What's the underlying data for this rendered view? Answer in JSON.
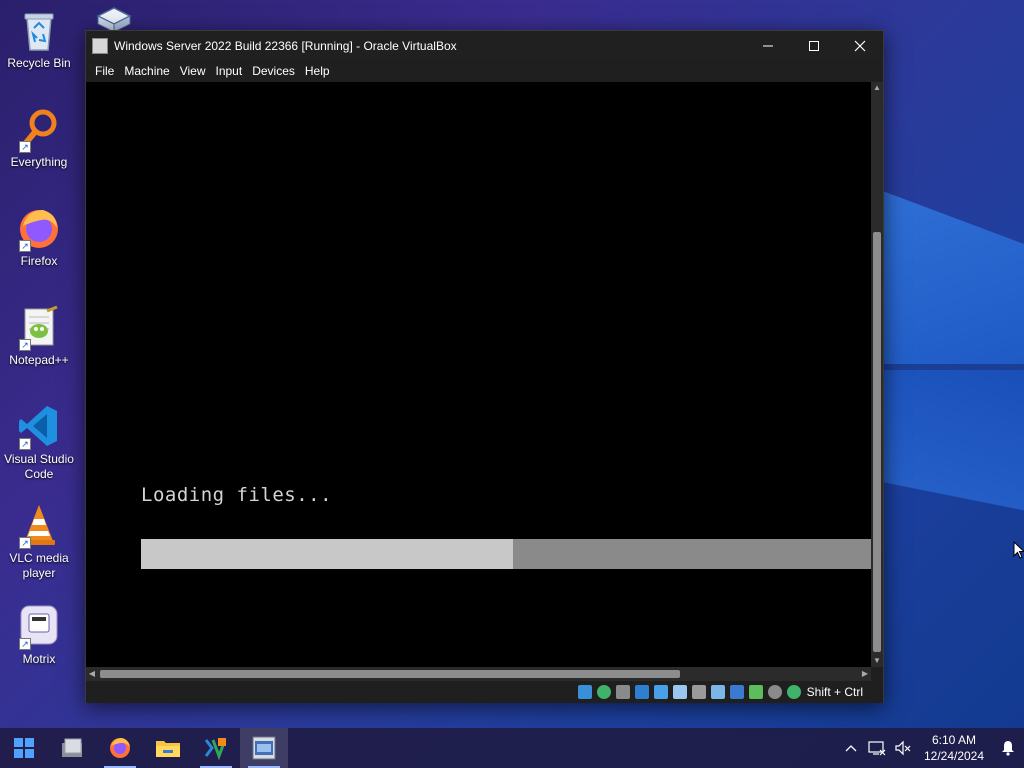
{
  "desktop": {
    "icons": [
      {
        "label": "Recycle Bin",
        "icon": "recycle-bin-icon"
      },
      {
        "label": "Everything",
        "icon": "everything-search-icon"
      },
      {
        "label": "Firefox",
        "icon": "firefox-icon"
      },
      {
        "label": "Notepad++",
        "icon": "notepadpp-icon"
      },
      {
        "label": "Visual Studio Code",
        "icon": "vscode-icon"
      },
      {
        "label": "VLC media player",
        "icon": "vlc-icon"
      },
      {
        "label": "Motrix",
        "icon": "motrix-icon"
      }
    ]
  },
  "window": {
    "title": "Windows Server 2022 Build 22366 [Running] - Oracle VirtualBox",
    "menu": [
      "File",
      "Machine",
      "View",
      "Input",
      "Devices",
      "Help"
    ],
    "vm_screen": {
      "status_text": "Loading files...",
      "progress_fraction": 0.51
    },
    "statusbar": {
      "host_key": "Shift + Ctrl"
    }
  },
  "taskbar": {
    "apps": [
      "start-icon",
      "file-manager-icon",
      "firefox-icon",
      "file-explorer-icon",
      "virtualbox-manager-icon",
      "virtualbox-vm-icon"
    ],
    "clock": {
      "time": "6:10 AM",
      "date": "12/24/2024"
    }
  },
  "colors": {
    "titlebar": "#202020",
    "vm_background": "#000000",
    "progress_fill": "#c8c8c8",
    "progress_track": "#8a8a8a"
  }
}
